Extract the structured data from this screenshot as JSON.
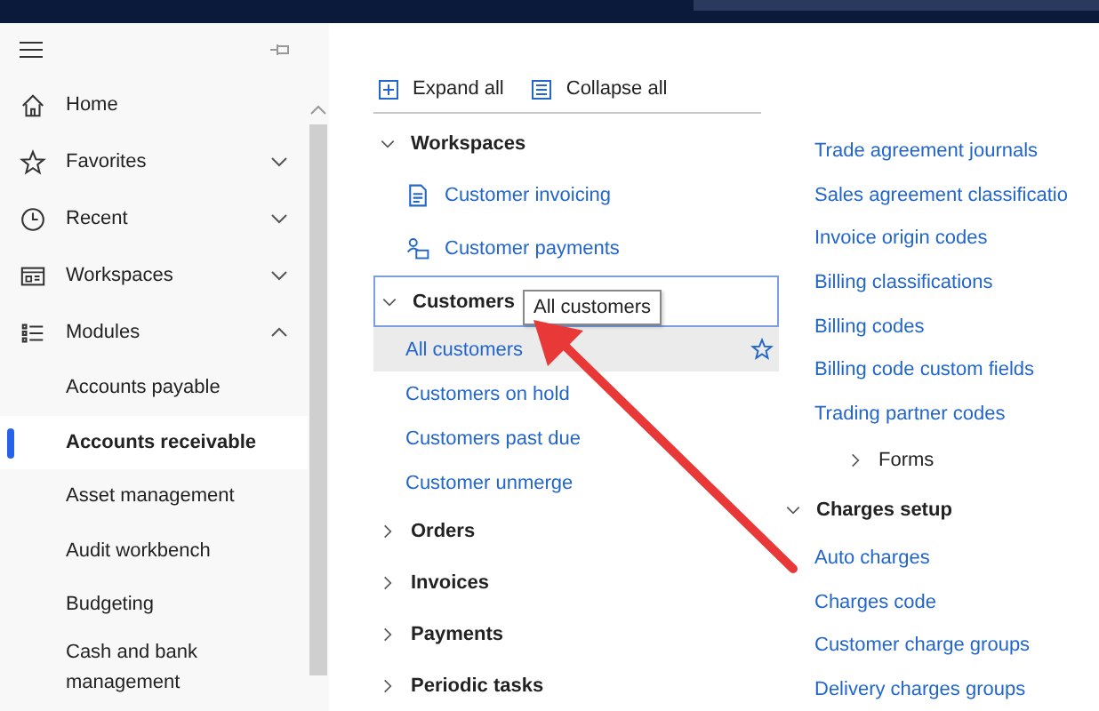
{
  "sidebar": {
    "items": [
      {
        "label": "Home",
        "expandable": false
      },
      {
        "label": "Favorites",
        "expandable": true,
        "expanded": false
      },
      {
        "label": "Recent",
        "expandable": true,
        "expanded": false
      },
      {
        "label": "Workspaces",
        "expandable": true,
        "expanded": false
      },
      {
        "label": "Modules",
        "expandable": true,
        "expanded": true,
        "children": [
          {
            "label": "Accounts payable",
            "selected": false
          },
          {
            "label": "Accounts receivable",
            "selected": true
          },
          {
            "label": "Asset management",
            "selected": false
          },
          {
            "label": "Audit workbench",
            "selected": false
          },
          {
            "label": "Budgeting",
            "selected": false
          },
          {
            "label": "Cash and bank management",
            "selected": false
          }
        ]
      }
    ]
  },
  "toolbar": {
    "buttons": [
      "Expand all",
      "Collapse all"
    ]
  },
  "left_column": {
    "sections": [
      {
        "title": "Workspaces",
        "expanded": true,
        "focused": false,
        "items": [
          {
            "label": "Customer invoicing",
            "selected": false
          },
          {
            "label": "Customer payments",
            "selected": false
          }
        ]
      },
      {
        "title": "Customers",
        "expanded": true,
        "focused": true,
        "items": [
          {
            "label": "All customers",
            "selected": true
          },
          {
            "label": "Customers on hold",
            "selected": false
          },
          {
            "label": "Customers past due",
            "selected": false
          },
          {
            "label": "Customer unmerge",
            "selected": false
          }
        ]
      },
      {
        "title": "Orders",
        "expanded": false,
        "focused": false
      },
      {
        "title": "Invoices",
        "expanded": false,
        "focused": false
      },
      {
        "title": "Payments",
        "expanded": false,
        "focused": false
      },
      {
        "title": "Periodic tasks",
        "expanded": false,
        "focused": false
      }
    ]
  },
  "tooltip": "All customers",
  "right_column": {
    "links": [
      "Trade agreement journals",
      "Sales agreement classificatio",
      "Invoice origin codes",
      "Billing classifications",
      "Billing codes",
      "Billing code custom fields",
      "Trading partner codes"
    ],
    "groups": [
      {
        "title": "Forms",
        "expanded": false
      }
    ],
    "sections": [
      {
        "title": "Charges setup",
        "expanded": true,
        "items": [
          "Auto charges",
          "Charges code",
          "Customer charge groups",
          "Delivery charges groups"
        ]
      }
    ]
  }
}
